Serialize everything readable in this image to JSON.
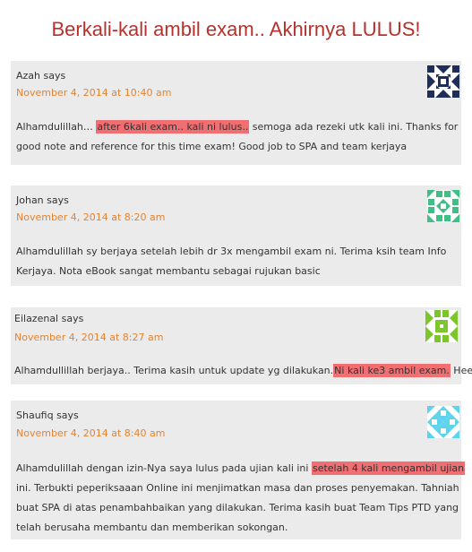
{
  "page_title": "Berkali-kali ambil exam.. Akhirnya LULUS!",
  "colors": {
    "title": "#b7312c",
    "date": "#e8822e",
    "highlight": "#ef6f73",
    "card": "#ebebeb"
  },
  "comments": [
    {
      "author": "Azah says",
      "date": "November 4, 2014 at 10:40 am",
      "avatar_icon": "identicon-navy-avatar",
      "lines": [
        {
          "before": "Alhamdulillah… ",
          "highlight": "after 6kali exam.. kali ni lulus..",
          "after": " semoga ada rezeki utk kali ini. Thanks for"
        },
        {
          "before": "good note and reference for this time exam! Good job to SPA and team kerjaya",
          "highlight": "",
          "after": ""
        }
      ]
    },
    {
      "author": "Johan says",
      "date": "November 4, 2014 at 8:20 am",
      "avatar_icon": "identicon-green-avatar",
      "lines": [
        {
          "before": "Alhamdulillah sy berjaya setelah lebih dr 3x mengambil exam ni. Terima ksih team Info",
          "highlight": "",
          "after": ""
        },
        {
          "before": "Kerjaya. Nota eBook sangat membantu sebagai rujukan basic",
          "highlight": "",
          "after": ""
        }
      ]
    },
    {
      "author": "Eilazenal says",
      "date": "November 4, 2014 at 8:27 am",
      "avatar_icon": "identicon-lime-avatar",
      "lines": [
        {
          "before": "Alhamdullillah berjaya.. Terima kasih untuk update yg dilakukan.",
          "highlight": "Ni kali ke3 ambil exam.",
          "after": " Hee"
        }
      ]
    },
    {
      "author": "Shaufiq says",
      "date": "November 4, 2014 at 8:40 am",
      "avatar_icon": "identicon-cyan-avatar",
      "lines": [
        {
          "before": "Alhamdulillah dengan izin-Nya saya lulus pada ujian kali ini ",
          "highlight": "setelah 4 kali mengambil ujian",
          "after": ""
        },
        {
          "before": "ini. Terbukti peperiksaaan Online ini menjimatkan masa dan proses penyemakan. Tahniah",
          "highlight": "",
          "after": ""
        },
        {
          "before": "buat SPA di atas penambahbaikan yang dilakukan. Terima kasih buat Team Tips PTD yang",
          "highlight": "",
          "after": ""
        },
        {
          "before": "telah berusaha membantu dan memberikan sokongan.",
          "highlight": "",
          "after": ""
        }
      ]
    }
  ]
}
